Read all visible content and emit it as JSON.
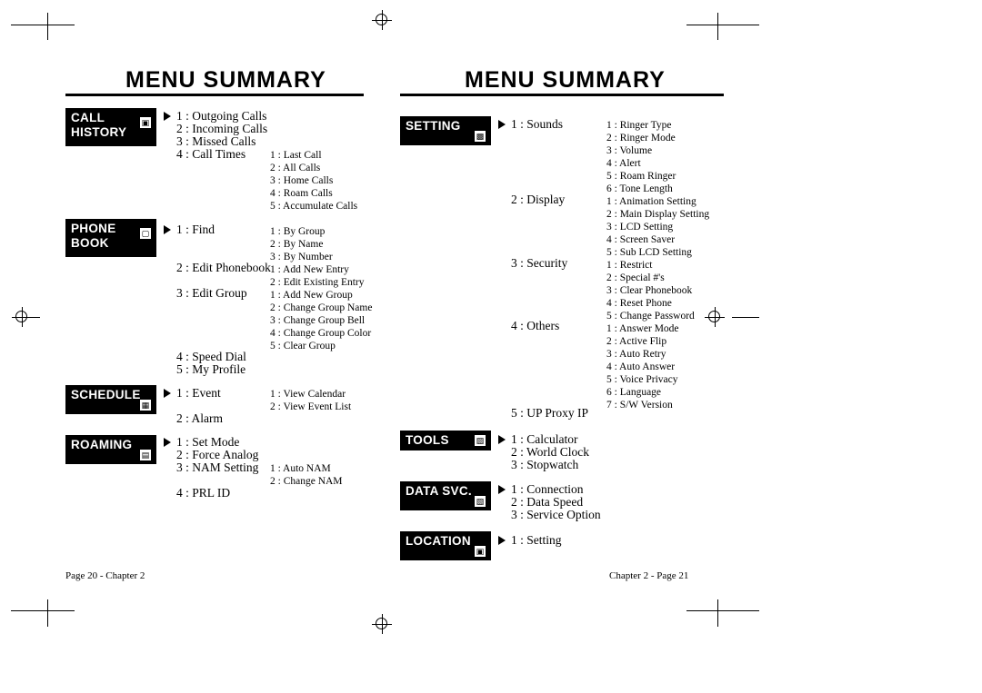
{
  "left_page": {
    "title": "MENU SUMMARY",
    "footer": "Page 20 - Chapter 2",
    "sections": [
      {
        "label_lines": [
          "CALL",
          "HISTORY"
        ],
        "icon": "phone-history-icon",
        "level1": [
          "1 : Outgoing Calls",
          "2 : Incoming Calls",
          "3 : Missed Calls",
          "4 : Call Times"
        ],
        "level2": [
          "1 : Last Call",
          "2 : All Calls",
          "3 : Home Calls",
          "4 : Roam Calls",
          "5 : Accumulate Calls"
        ]
      },
      {
        "label_lines": [
          "PHONE",
          "BOOK"
        ],
        "icon": "phonebook-icon",
        "level1": [
          "1 : Find",
          "2 : Edit Phonebook",
          "3 : Edit Group",
          "4 : Speed Dial",
          "5 : My Profile"
        ],
        "level2_find": [
          "1 : By Group",
          "2 : By Name",
          "3 : By Number"
        ],
        "level2_edit_phonebook": [
          "1 : Add New Entry",
          "2 : Edit Existing Entry"
        ],
        "level2_edit_group": [
          "1 : Add New Group",
          "2 : Change Group Name",
          "3 : Change Group Bell",
          "4 : Change Group Color",
          "5 : Clear Group"
        ]
      },
      {
        "label_lines": [
          "SCHEDULE"
        ],
        "icon": "calendar-icon",
        "level1": [
          "1 : Event",
          "2 : Alarm"
        ],
        "level2": [
          "1 : View Calendar",
          "2 : View Event List"
        ]
      },
      {
        "label_lines": [
          "ROAMING"
        ],
        "icon": "roaming-icon",
        "level1": [
          "1 : Set Mode",
          "2 : Force Analog",
          "3 : NAM Setting",
          "4 : PRL ID"
        ],
        "level2": [
          "1 : Auto NAM",
          "2 : Change NAM"
        ]
      }
    ]
  },
  "right_page": {
    "title": "MENU SUMMARY",
    "footer": "Chapter 2 - Page 21",
    "sections": [
      {
        "label_lines": [
          "SETTING"
        ],
        "icon": "settings-icon",
        "level1": [
          "1 : Sounds",
          "2 : Display",
          "3 : Security",
          "4 : Others",
          "5 : UP Proxy IP"
        ],
        "level2_sounds": [
          "1 : Ringer Type",
          "2 : Ringer Mode",
          "3 : Volume",
          "4 : Alert",
          "5 : Roam Ringer",
          "6 : Tone Length"
        ],
        "level2_display": [
          "1 : Animation Setting",
          "2 : Main Display Setting",
          "3 : LCD Setting",
          "4 : Screen Saver",
          "5 : Sub LCD Setting"
        ],
        "level2_security": [
          "1 : Restrict",
          "2 : Special #'s",
          "3 : Clear Phonebook",
          "4 : Reset Phone",
          "5 : Change Password"
        ],
        "level2_others": [
          "1 : Answer Mode",
          "2 : Active Flip",
          "3 : Auto Retry",
          "4 : Auto Answer",
          "5 : Voice Privacy",
          "6 : Language",
          "7 : S/W Version"
        ]
      },
      {
        "label_lines": [
          "TOOLS"
        ],
        "icon": "tools-icon",
        "level1": [
          "1 : Calculator",
          "2 : World Clock",
          "3 : Stopwatch"
        ]
      },
      {
        "label_lines": [
          "DATA SVC."
        ],
        "icon": "data-service-icon",
        "level1": [
          "1 : Connection",
          "2 : Data Speed",
          "3 : Service Option"
        ]
      },
      {
        "label_lines": [
          "LOCATION"
        ],
        "icon": "location-icon",
        "level1": [
          "1 : Setting"
        ]
      }
    ]
  }
}
